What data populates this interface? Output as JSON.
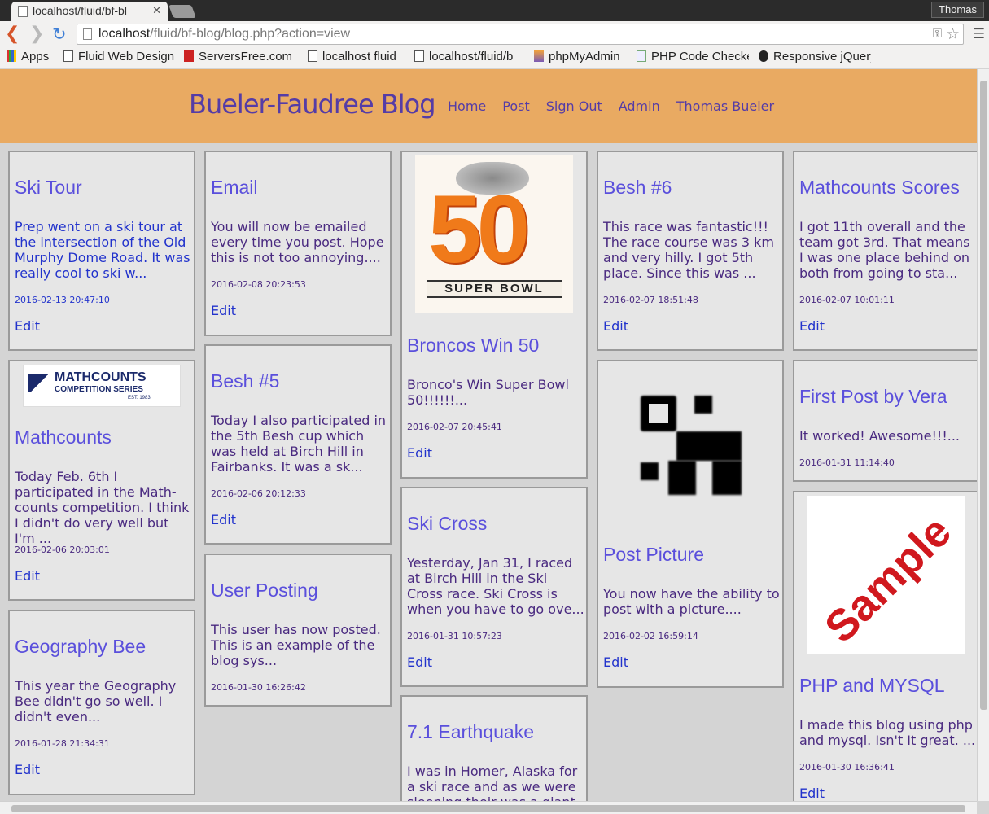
{
  "browser": {
    "tab_title": "localhost/fluid/bf-bl",
    "user": "Thomas",
    "url_host": "localhost",
    "url_path": "/fluid/bf-blog/blog.php?action=view",
    "bookmarks": [
      "Apps",
      "Fluid Web Design",
      "ServersFree.com",
      "localhost fluid",
      "localhost/fluid/b",
      "phpMyAdmin",
      "PHP Code Checker",
      "Responsive jQuery"
    ]
  },
  "site": {
    "title": "Bueler-Faudree Blog",
    "nav": [
      "Home",
      "Post",
      "Sign Out",
      "Admin",
      "Thomas Bueler"
    ]
  },
  "posts": [
    {
      "title": "Ski Tour",
      "excerpt": "Prep went on a ski tour at the intersection of the Old Murphy Dome Road. It was really cool to ski w...",
      "date": "2016-02-13 20:47:10",
      "edit": "Edit"
    },
    {
      "title": "Email",
      "excerpt": "You will now be emailed every time you post. Hope this is not too annoying....",
      "date": "2016-02-08 20:23:53",
      "edit": "Edit"
    },
    {
      "title": "Broncos Win 50",
      "excerpt": "Bronco's Win Super Bowl 50!!!!!!...",
      "date": "2016-02-07 20:45:41",
      "edit": "Edit",
      "image_label": "SUPER BOWL"
    },
    {
      "title": "Besh #6",
      "excerpt": "This race was fantastic!!! The race course was 3 km and very hilly. I got 5th place. Since this was ...",
      "date": "2016-02-07 18:51:48",
      "edit": "Edit"
    },
    {
      "title": "Mathcounts Scores",
      "excerpt": "I got 11th overall and the team got 3rd. That means I was one place behind on both from going to sta...",
      "date": "2016-02-07 10:01:11",
      "edit": "Edit"
    },
    {
      "title": "Mathcounts",
      "excerpt": "Today Feb. 6th I participated in the Math-counts competition. I think I didn't do very well but I'm ...",
      "date": "2016-02-06 20:03:01",
      "edit": "Edit",
      "logo_main": "MATHCOUNTS",
      "logo_sub": "COMPETITION SERIES",
      "logo_est": "EST. 1983"
    },
    {
      "title": "Besh #5",
      "excerpt": "Today I also participated in the 5th Besh cup which was held at Birch Hill in Fairbanks. It was a sk...",
      "date": "2016-02-06 20:12:33",
      "edit": "Edit"
    },
    {
      "title": "Ski Cross",
      "excerpt": "Yesterday, Jan 31, I raced at Birch Hill in the Ski Cross race. Ski Cross is when you have to go ove...",
      "date": "2016-01-31 10:57:23",
      "edit": "Edit"
    },
    {
      "title": "First Post by Vera",
      "excerpt": "It worked! Awesome!!!...",
      "date": "2016-01-31 11:14:40",
      "edit": "Edit"
    },
    {
      "title": "Post Picture",
      "excerpt": "You now have the ability to post with a picture....",
      "date": "2016-02-02 16:59:14",
      "edit": "Edit"
    },
    {
      "title": "User Posting",
      "excerpt": "This user has now posted. This is an example of the blog sys...",
      "date": "2016-01-30 16:26:42",
      "edit": "Edit"
    },
    {
      "title": "Geography Bee",
      "excerpt": "This year the Geography Bee didn't go so well. I didn't even...",
      "date": "2016-01-28 21:34:31",
      "edit": "Edit"
    },
    {
      "title": "PHP and MYSQL",
      "excerpt": "I made this blog using php and mysql. Isn't It great. ...",
      "date": "2016-01-30 16:36:41",
      "edit": "Edit",
      "image_label": "Sample"
    },
    {
      "title": "7.1 Earthquake",
      "excerpt": "I was in Homer, Alaska for a ski race and as we were sleeping their was a giant",
      "date": "",
      "edit": ""
    }
  ]
}
